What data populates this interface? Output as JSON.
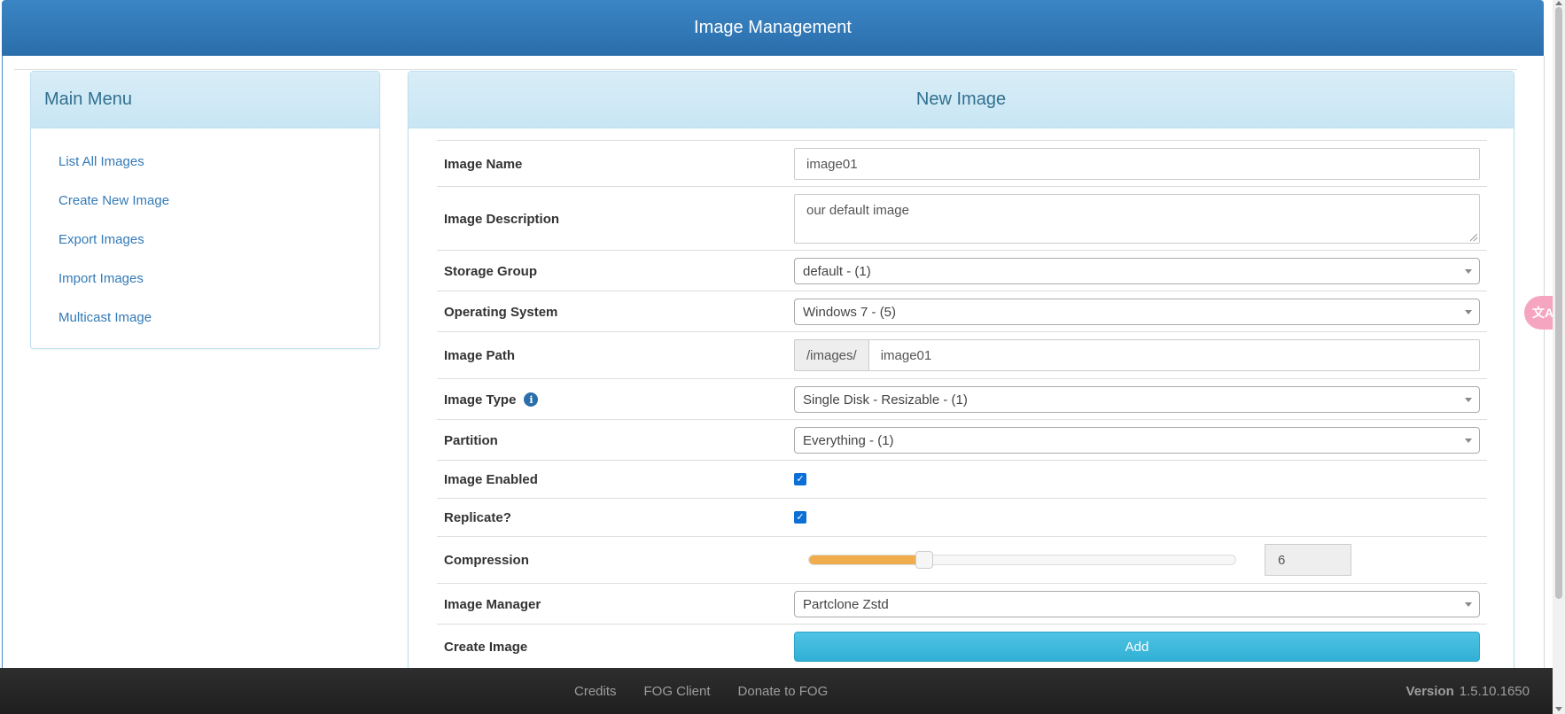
{
  "header": {
    "title": "Image Management"
  },
  "menu": {
    "title": "Main Menu",
    "items": [
      {
        "label": "List All Images"
      },
      {
        "label": "Create New Image"
      },
      {
        "label": "Export Images"
      },
      {
        "label": "Import Images"
      },
      {
        "label": "Multicast Image"
      }
    ]
  },
  "form": {
    "title": "New Image",
    "image_name": {
      "label": "Image Name",
      "value": "image01"
    },
    "image_description": {
      "label": "Image Description",
      "value": "our default image"
    },
    "storage_group": {
      "label": "Storage Group",
      "value": "default - (1)"
    },
    "operating_system": {
      "label": "Operating System",
      "value": "Windows 7 - (5)"
    },
    "image_path": {
      "label": "Image Path",
      "prefix": "/images/",
      "value": "image01"
    },
    "image_type": {
      "label": "Image Type",
      "value": "Single Disk - Resizable - (1)",
      "info_icon": "info-circle-icon"
    },
    "partition": {
      "label": "Partition",
      "value": "Everything - (1)"
    },
    "image_enabled": {
      "label": "Image Enabled",
      "checked": true
    },
    "replicate": {
      "label": "Replicate?",
      "checked": true
    },
    "compression": {
      "label": "Compression",
      "value": "6",
      "slider_fraction": 0.27,
      "fill_color": "#f0ad4e"
    },
    "image_manager": {
      "label": "Image Manager",
      "value": "Partclone Zstd"
    },
    "create_image": {
      "label": "Create Image",
      "button_label": "Add",
      "button_color": "#31b0d5"
    }
  },
  "footer": {
    "links": [
      {
        "label": "Credits"
      },
      {
        "label": "FOG Client"
      },
      {
        "label": "Donate to FOG"
      }
    ],
    "version_label": "Version",
    "version_value": "1.5.10.1650"
  },
  "colors": {
    "header": "#2a6eab",
    "panel_heading": "#d8edf7",
    "link": "#337ab7",
    "footer": "#222222"
  },
  "widgets": {
    "translate_icon": "translate-icon"
  }
}
